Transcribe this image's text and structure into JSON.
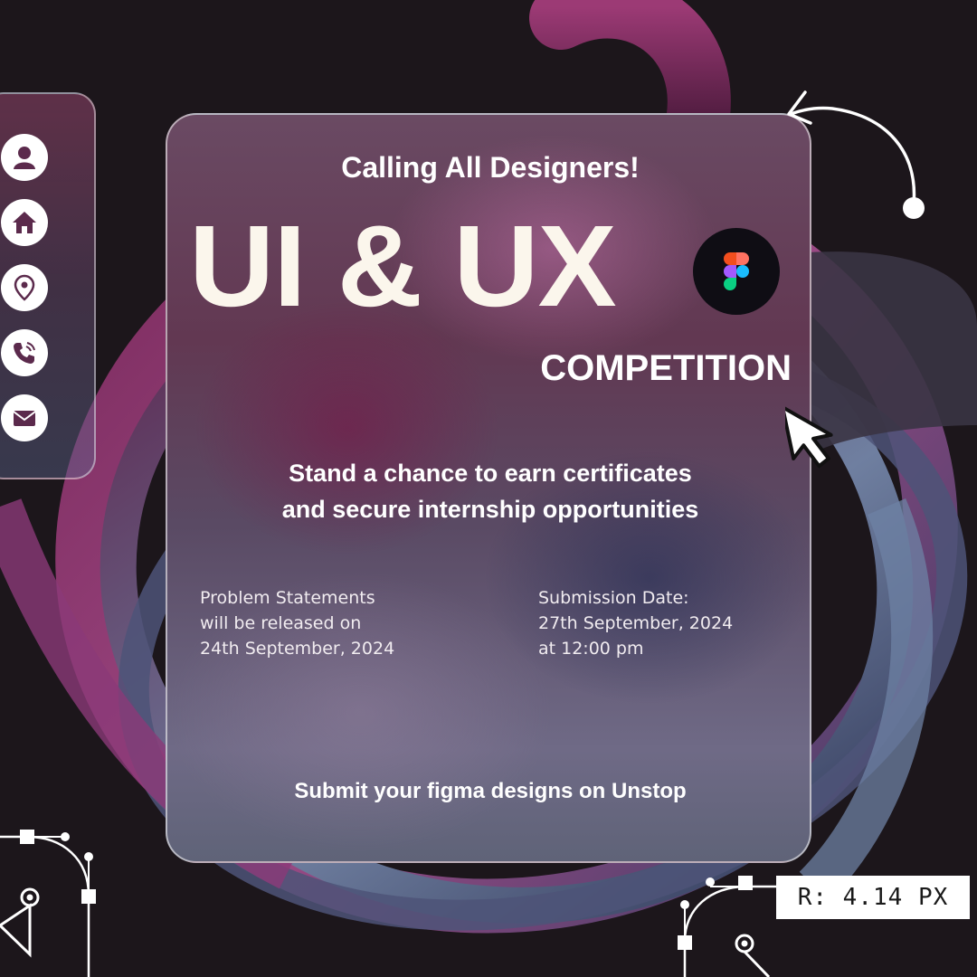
{
  "sidebar": {
    "icons": [
      "user-icon",
      "home-icon",
      "location-pin-icon",
      "phone-icon",
      "mail-icon"
    ]
  },
  "card": {
    "kicker": "Calling All Designers!",
    "headline": "UI & UX",
    "subheadline": "COMPETITION",
    "tagline_line1": "Stand a chance to earn certificates",
    "tagline_line2": "and secure internship opportunities",
    "info_left": "Problem Statements\nwill be released on\n24th September, 2024",
    "info_right": "Submission Date:\n27th September, 2024\nat 12:00 pm",
    "submit_text": "Submit your figma designs on Unstop"
  },
  "badge": {
    "icon": "figma-logo-icon"
  },
  "radius_tag": {
    "label": "R: 4.14 PX"
  },
  "colors": {
    "background": "#1c161b",
    "text": "#ffffff",
    "headline": "#fbf6ec",
    "figma_red": "#f24e1e",
    "figma_orange": "#ff7262",
    "figma_purple": "#a259ff",
    "figma_blue": "#1abcfe",
    "figma_green": "#0acf83"
  }
}
